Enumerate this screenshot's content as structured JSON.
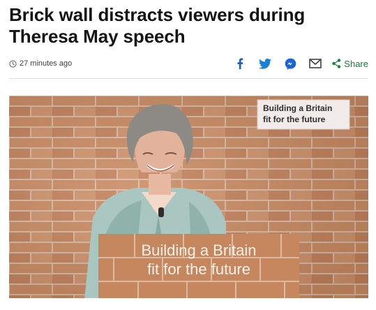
{
  "article": {
    "headline": "Brick wall distracts viewers during Theresa May speech",
    "timestamp": "27 minutes ago"
  },
  "share": {
    "icons": [
      "facebook-icon",
      "twitter-icon",
      "messenger-icon",
      "email-icon"
    ],
    "label": "Share",
    "accent": "#1a7f37"
  },
  "image": {
    "wall_sign": [
      "Building a Britain",
      "fit for the future"
    ],
    "podium_sign": [
      "Building a Britain",
      "fit for the future"
    ],
    "colors": {
      "brick": "#c6875f",
      "mortar": "#d8b8a2",
      "jacket": "#a9c6c0"
    }
  }
}
